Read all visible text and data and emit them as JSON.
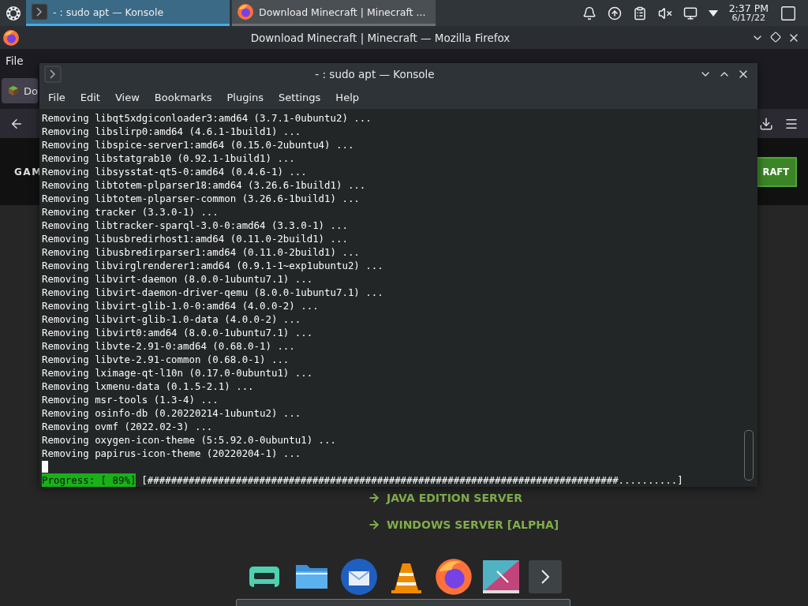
{
  "panel": {
    "tasks": [
      {
        "kind": "terminal",
        "title": "- : sudo apt — Konsole",
        "selected": true
      },
      {
        "kind": "browser",
        "title": "Download Minecraft | Minecraft ...",
        "selected": false
      }
    ],
    "clock": {
      "time": "2:37 PM",
      "date": "6/17/22"
    }
  },
  "firefox": {
    "title": "Download Minecraft | Minecraft — Mozilla Firefox",
    "menu": [
      "File"
    ],
    "tab": {
      "title": "Do"
    },
    "page": {
      "nav_label": "GAM",
      "button": "RAFT",
      "links": [
        "JAVA EDITION SERVER",
        "WINDOWS SERVER [ALPHA]"
      ]
    }
  },
  "konsole": {
    "title": "- : sudo apt — Konsole",
    "menu": [
      "File",
      "Edit",
      "View",
      "Bookmarks",
      "Plugins",
      "Settings",
      "Help"
    ],
    "lines": [
      "Removing libqt5xdgiconloader3:amd64 (3.7.1-0ubuntu2) ...",
      "Removing libslirp0:amd64 (4.6.1-1build1) ...",
      "Removing libspice-server1:amd64 (0.15.0-2ubuntu4) ...",
      "Removing libstatgrab10 (0.92.1-1build1) ...",
      "Removing libsysstat-qt5-0:amd64 (0.4.6-1) ...",
      "Removing libtotem-plparser18:amd64 (3.26.6-1build1) ...",
      "Removing libtotem-plparser-common (3.26.6-1build1) ...",
      "Removing tracker (3.3.0-1) ...",
      "Removing libtracker-sparql-3.0-0:amd64 (3.3.0-1) ...",
      "Removing libusbredirhost1:amd64 (0.11.0-2build1) ...",
      "Removing libusbredirparser1:amd64 (0.11.0-2build1) ...",
      "Removing libvirglrenderer1:amd64 (0.9.1-1~exp1ubuntu2) ...",
      "Removing libvirt-daemon (8.0.0-1ubuntu7.1) ...",
      "Removing libvirt-daemon-driver-qemu (8.0.0-1ubuntu7.1) ...",
      "Removing libvirt-glib-1.0-0:amd64 (4.0.0-2) ...",
      "Removing libvirt-glib-1.0-data (4.0.0-2) ...",
      "Removing libvirt0:amd64 (8.0.0-1ubuntu7.1) ...",
      "Removing libvte-2.91-0:amd64 (0.68.0-1) ...",
      "Removing libvte-2.91-common (0.68.0-1) ...",
      "Removing lximage-qt-l10n (0.17.0-0ubuntu1) ...",
      "Removing lxmenu-data (0.1.5-2.1) ...",
      "Removing msr-tools (1.3-4) ...",
      "Removing osinfo-db (0.20220214-1ubuntu2) ...",
      "Removing ovmf (2022.02-3) ...",
      "Removing oxygen-icon-theme (5:5.92.0-0ubuntu1) ...",
      "Removing papirus-icon-theme (20220204-1) ..."
    ],
    "progress": {
      "label": "Progress: [ 89%]",
      "bar": "[################################################################################..........]"
    }
  }
}
